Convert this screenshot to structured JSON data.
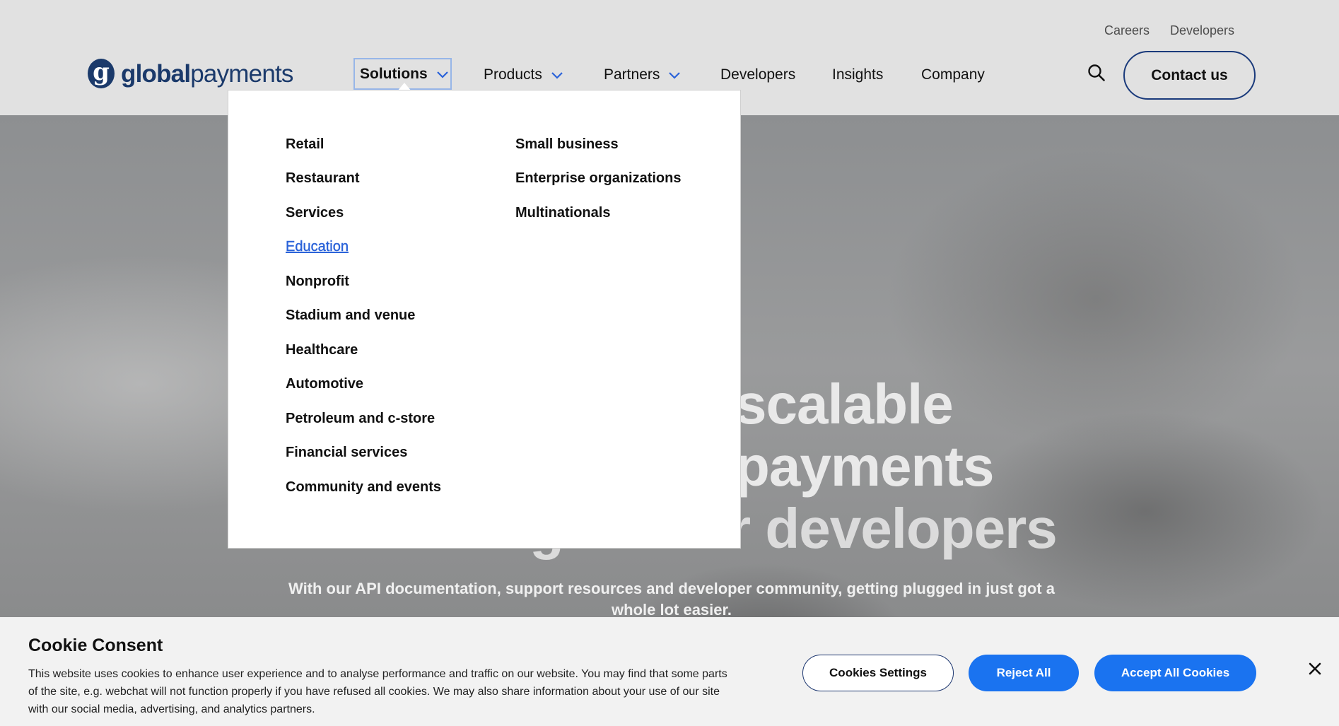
{
  "header": {
    "utility_links": [
      "Careers",
      "Developers"
    ],
    "logo": {
      "bold": "global",
      "regular": "payments",
      "mark": "g"
    },
    "nav": {
      "solutions": "Solutions",
      "products": "Products",
      "partners": "Partners",
      "developers": "Developers",
      "insights": "Insights",
      "company": "Company"
    },
    "contact_label": "Contact us"
  },
  "dropdown": {
    "left_column": [
      "Retail",
      "Restaurant",
      "Services",
      "Education",
      "Nonprofit",
      "Stadium and venue",
      "Healthcare",
      "Automotive",
      "Petroleum and c-store",
      "Financial services",
      "Community and events"
    ],
    "right_column": [
      "Small business",
      "Enterprise organizations",
      "Multinationals"
    ],
    "active_item": "Education"
  },
  "hero": {
    "line1": "scalable",
    "line2": "payments",
    "line3": "APIs designed for developers",
    "subtitle": "With our API documentation, support resources and developer community, getting plugged in just got a whole lot easier."
  },
  "cookie": {
    "title": "Cookie Consent",
    "text": "This website uses cookies to enhance user experience and to analyse performance and traffic on our website. You may find that some parts of the site, e.g. webchat will not function properly if you have refused all cookies. We may also share information about your use of our site with our social media, advertising, and analytics partners.",
    "settings_label": "Cookies Settings",
    "reject_label": "Reject All",
    "accept_label": "Accept All Cookies"
  },
  "colors": {
    "brand_navy": "#1b3a6b",
    "accent_blue": "#1a73f0",
    "link_blue": "#2b63d9"
  },
  "icons": [
    "chevron-down-icon",
    "search-icon",
    "close-icon"
  ]
}
